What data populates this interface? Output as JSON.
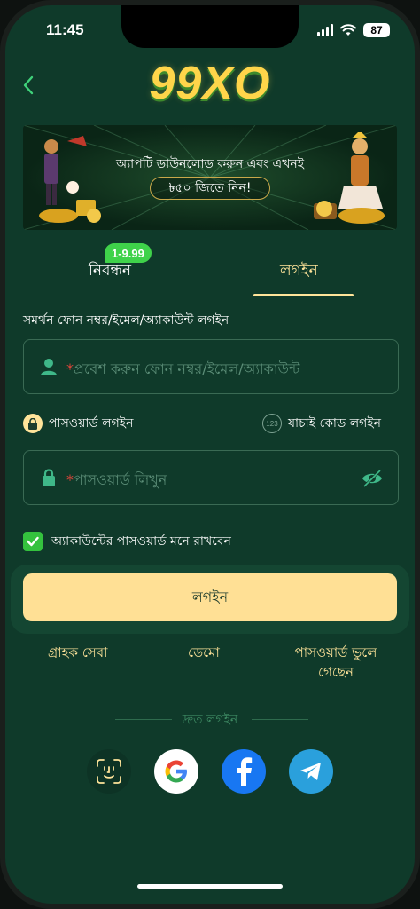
{
  "status": {
    "time": "11:45",
    "battery": "87"
  },
  "header": {
    "logo": "99XO",
    "back_icon": "chevron-left-icon"
  },
  "banner": {
    "line1": "অ্যাপটি ডাউনলোড করুন এবং এখনই",
    "line2": "৳৫০ জিতে নিন!"
  },
  "tabs": [
    {
      "label": "নিবন্ধন",
      "badge": "1-9.99",
      "active": false
    },
    {
      "label": "লগইন",
      "active": true
    }
  ],
  "form": {
    "support_label": "সমর্থন ফোন নম্বর/ইমেল/অ্যাকাউন্ট লগইন",
    "account_placeholder": "প্রবেশ করুন ফোন নম্বর/ইমেল/অ্যাকাউন্ট",
    "required_mark": "*",
    "mode_password": "পাসওয়ার্ড লগইন",
    "mode_code": "যাচাই কোড লগইন",
    "mode_code_icon_text": "123",
    "password_placeholder": "পাসওয়ার্ড লিখুন",
    "remember_label": "অ্যাকাউন্টের পাসওয়ার্ড মনে রাখবেন",
    "remember_checked": true,
    "login_button": "লগইন"
  },
  "links": {
    "customer_service": "গ্রাহক সেবা",
    "demo": "ডেমো",
    "forgot_password": "পাসওয়ার্ড ভুলে গেছেন"
  },
  "quick_login": {
    "label": "দ্রুত লগইন",
    "methods": [
      "face-id-icon",
      "google-icon",
      "facebook-icon",
      "telegram-icon"
    ]
  },
  "colors": {
    "background": "#0f3a2a",
    "accent": "#ffe49a",
    "button": "#ffe095",
    "badge": "#3fd24a",
    "checkbox": "#34c23e"
  }
}
